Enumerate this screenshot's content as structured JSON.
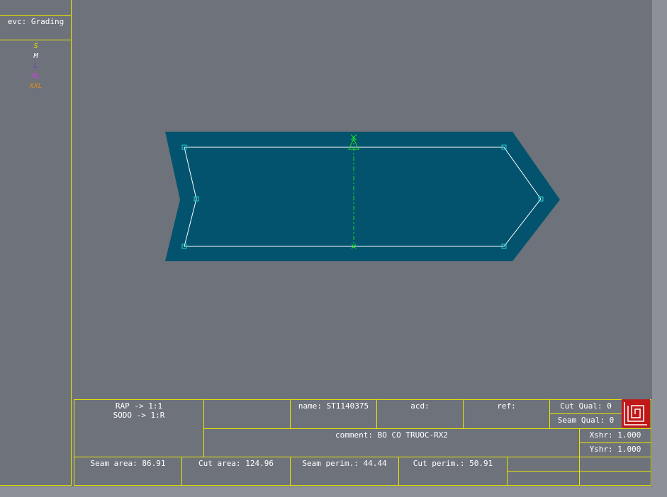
{
  "sidebar": {
    "mode": "evc: Grading",
    "sizes": [
      {
        "label": "S",
        "color": "#e6e600"
      },
      {
        "label": "M",
        "color": "#ffffff"
      },
      {
        "label": "L",
        "color": "#7a3cc8"
      },
      {
        "label": "XL",
        "color": "#d040e0"
      },
      {
        "label": "XXL",
        "color": "#e08a20"
      }
    ]
  },
  "piece": {
    "fill_color": "#03536e",
    "outline_color": "#ffffff",
    "point_color": "#20d0d0",
    "grain_color": "#20e020"
  },
  "info": {
    "rap": "RAP -> 1:1",
    "sodo": "SODO -> 1:R",
    "name": "name: ST1140375",
    "acd": "acd:",
    "ref": "ref:",
    "cut_qual": "Cut Qual: 0",
    "seam_qual": "Seam Qual: 0",
    "comment": "comment: BO CO TRUOC-RX2",
    "xshr": "Xshr: 1.000",
    "yshr": "Yshr: 1.000",
    "seam_area": "Seam area: 86.91",
    "cut_area": "Cut area: 124.96",
    "seam_perim": "Seam perim.: 44.44",
    "cut_perim": "Cut perim.: 50.91"
  }
}
